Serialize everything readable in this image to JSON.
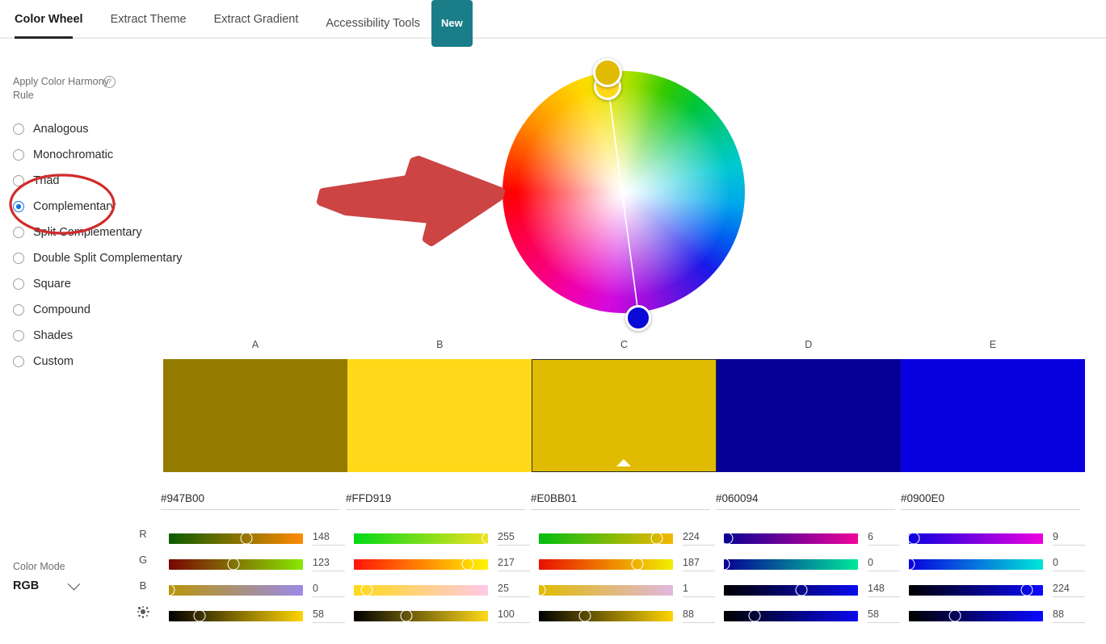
{
  "tabs": [
    {
      "label": "Color Wheel",
      "active": true
    },
    {
      "label": "Extract Theme",
      "active": false
    },
    {
      "label": "Extract Gradient",
      "active": false
    },
    {
      "label": "Accessibility Tools",
      "active": false
    }
  ],
  "badge": {
    "label": "New",
    "color": "#1a7d87"
  },
  "harmony": {
    "title": "Apply Color Harmony Rule",
    "help": "?",
    "selected": "Complementary",
    "options": [
      "Analogous",
      "Monochromatic",
      "Triad",
      "Complementary",
      "Split Complementary",
      "Double Split Complementary",
      "Square",
      "Compound",
      "Shades",
      "Custom"
    ]
  },
  "color_mode": {
    "label": "Color Mode",
    "value": "RGB"
  },
  "channel_labels": [
    "R",
    "G",
    "B"
  ],
  "brightness_icon": "brightness-icon",
  "wheel": {
    "markers": [
      {
        "name": "marker-gold",
        "color": "#E0BB01"
      },
      {
        "name": "marker-yellow",
        "color": "#FFD919"
      },
      {
        "name": "marker-blue",
        "color": "#0A0AD8"
      }
    ]
  },
  "swatches": [
    {
      "letter": "A",
      "hex": "#947B00",
      "fill": "#947B00",
      "selected": false,
      "channels": [
        {
          "label": "R",
          "value": 148,
          "from": "#0b5c00",
          "to": "#ff8a00"
        },
        {
          "label": "G",
          "value": 123,
          "from": "#7a0505",
          "to": "#8ae800"
        },
        {
          "label": "B",
          "value": 0,
          "from": "#b8960a",
          "to": "#9b8ae8"
        },
        {
          "label": "brightness",
          "value": 58,
          "from": "#000000",
          "to": "#ffd400"
        }
      ]
    },
    {
      "letter": "B",
      "hex": "#FFD919",
      "fill": "#FFD919",
      "selected": false,
      "channels": [
        {
          "label": "R",
          "value": 255,
          "from": "#00d916",
          "to": "#efe320"
        },
        {
          "label": "G",
          "value": 217,
          "from": "#ff1408",
          "to": "#fff500"
        },
        {
          "label": "B",
          "value": 25,
          "from": "#ffd919",
          "to": "#ffc9e8"
        },
        {
          "label": "brightness",
          "value": 100,
          "from": "#000000",
          "to": "#ffd919"
        }
      ]
    },
    {
      "letter": "C",
      "hex": "#E0BB01",
      "fill": "#E0BB01",
      "selected": true,
      "channels": [
        {
          "label": "R",
          "value": 224,
          "from": "#00bd10",
          "to": "#f5b800"
        },
        {
          "label": "G",
          "value": 187,
          "from": "#e81000",
          "to": "#f2ef00"
        },
        {
          "label": "B",
          "value": 1,
          "from": "#e0bb01",
          "to": "#e0b8e0"
        },
        {
          "label": "brightness",
          "value": 88,
          "from": "#000000",
          "to": "#ffd400"
        }
      ]
    },
    {
      "letter": "D",
      "hex": "#060094",
      "fill": "#060094",
      "selected": false,
      "channels": [
        {
          "label": "R",
          "value": 6,
          "from": "#060094",
          "to": "#f0049b"
        },
        {
          "label": "G",
          "value": 0,
          "from": "#060094",
          "to": "#00e89b"
        },
        {
          "label": "B",
          "value": 148,
          "from": "#000000",
          "to": "#0a0aef"
        },
        {
          "label": "brightness",
          "value": 58,
          "from": "#000000",
          "to": "#0a0aef"
        }
      ]
    },
    {
      "letter": "E",
      "hex": "#0900E0",
      "fill": "#0900E0",
      "selected": false,
      "channels": [
        {
          "label": "R",
          "value": 9,
          "from": "#0900e0",
          "to": "#f000e0"
        },
        {
          "label": "G",
          "value": 0,
          "from": "#0900e0",
          "to": "#00e8d8"
        },
        {
          "label": "B",
          "value": 224,
          "from": "#000000",
          "to": "#0a0aff"
        },
        {
          "label": "brightness",
          "value": 88,
          "from": "#000000",
          "to": "#0a0aff"
        }
      ]
    }
  ],
  "annotations": {
    "arrow_color": "#cc4444",
    "ellipse_color": "#d12b2b"
  }
}
